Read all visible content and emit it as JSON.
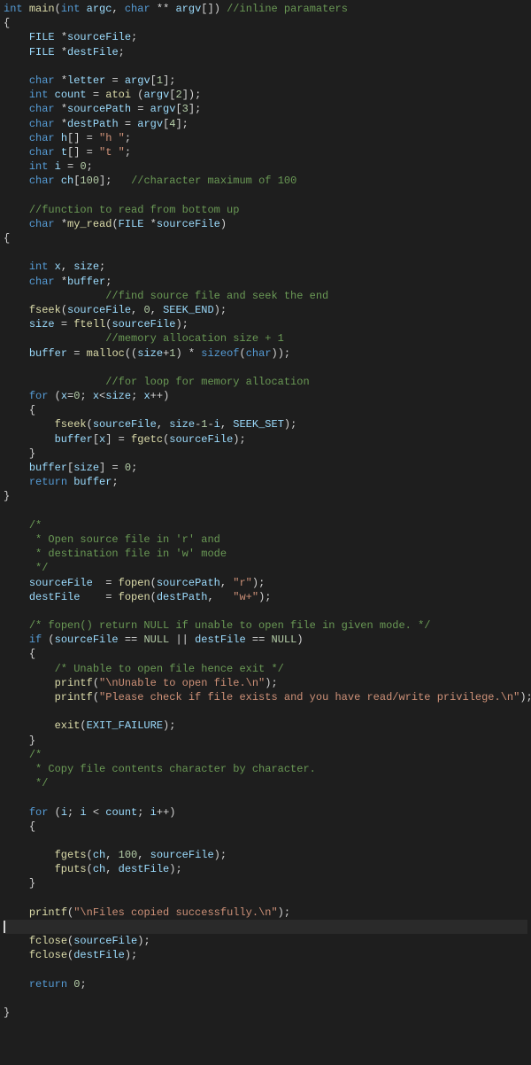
{
  "l": {
    "0": {
      "a": "int",
      "b": "main",
      "c": "int",
      "d": "argc",
      "e": "char",
      "f": "argv",
      "g": "//inline paramaters"
    },
    "1": {
      "a": "{"
    },
    "2": {
      "a": "FILE",
      "b": "sourceFile"
    },
    "3": {
      "a": "FILE",
      "b": "destFile"
    },
    "5": {
      "a": "char",
      "b": "letter",
      "c": "argv",
      "d": "1"
    },
    "6": {
      "a": "int",
      "b": "count",
      "c": "atoi",
      "d": "argv",
      "e": "2"
    },
    "7": {
      "a": "char",
      "b": "sourcePath",
      "c": "argv",
      "d": "3"
    },
    "8": {
      "a": "char",
      "b": "destPath",
      "c": "argv",
      "d": "4"
    },
    "9": {
      "a": "char",
      "b": "h",
      "c": "\"h \""
    },
    "10": {
      "a": "char",
      "b": "t",
      "c": "\"t \""
    },
    "11": {
      "a": "int",
      "b": "i",
      "c": "0"
    },
    "12": {
      "a": "char",
      "b": "ch",
      "c": "100",
      "d": "//character maximum of 100"
    },
    "14": {
      "a": "//function to read from bottom up"
    },
    "15": {
      "a": "char",
      "b": "my_read",
      "c": "FILE",
      "d": "sourceFile"
    },
    "16": {
      "a": "{"
    },
    "18": {
      "a": "int",
      "b": "x",
      "c": "size"
    },
    "19": {
      "a": "char",
      "b": "buffer"
    },
    "20": {
      "a": "//find source file and seek the end"
    },
    "21": {
      "a": "fseek",
      "b": "sourceFile",
      "c": "0",
      "d": "SEEK_END"
    },
    "22": {
      "a": "size",
      "b": "ftell",
      "c": "sourceFile"
    },
    "23": {
      "a": "//memory allocation size + 1"
    },
    "24": {
      "a": "buffer",
      "b": "malloc",
      "c": "size",
      "d": "1",
      "e": "sizeof",
      "f": "char"
    },
    "26": {
      "a": "//for loop for memory allocation"
    },
    "27": {
      "a": "for",
      "b": "x",
      "c": "0",
      "d": "x",
      "e": "size",
      "f": "x"
    },
    "28": {
      "a": "{"
    },
    "29": {
      "a": "fseek",
      "b": "sourceFile",
      "c": "size",
      "d": "1",
      "e": "i",
      "f": "SEEK_SET"
    },
    "30": {
      "a": "buffer",
      "b": "x",
      "c": "fgetc",
      "d": "sourceFile"
    },
    "31": {
      "a": "}"
    },
    "32": {
      "a": "buffer",
      "b": "size",
      "c": "0"
    },
    "33": {
      "a": "return",
      "b": "buffer"
    },
    "34": {
      "a": "}"
    },
    "36": {
      "a": "/*"
    },
    "37": {
      "a": "     * Open source file in 'r' and"
    },
    "38": {
      "a": "     * destination file in 'w' mode"
    },
    "39": {
      "a": "     */"
    },
    "40": {
      "a": "sourceFile",
      "b": "fopen",
      "c": "sourcePath",
      "d": "\"r\""
    },
    "41": {
      "a": "destFile",
      "b": "fopen",
      "c": "destPath",
      "d": "\"w+\""
    },
    "43": {
      "a": "/* fopen() return NULL if unable to open file in given mode. */"
    },
    "44": {
      "a": "if",
      "b": "sourceFile",
      "c": "NULL",
      "d": "destFile",
      "e": "NULL"
    },
    "45": {
      "a": "{"
    },
    "46": {
      "a": "/* Unable to open file hence exit */"
    },
    "47": {
      "a": "printf",
      "b": "\"\\nUnable to open file.\\n\""
    },
    "48": {
      "a": "printf",
      "b": "\"Please check if file exists and you have read/write privilege.\\n\""
    },
    "50": {
      "a": "exit",
      "b": "EXIT_FAILURE"
    },
    "51": {
      "a": "}"
    },
    "52": {
      "a": "/*"
    },
    "53": {
      "a": "     * Copy file contents character by character."
    },
    "54": {
      "a": "     */"
    },
    "56": {
      "a": "for",
      "b": "i",
      "c": "i",
      "d": "count",
      "e": "i"
    },
    "57": {
      "a": "{"
    },
    "59": {
      "a": "fgets",
      "b": "ch",
      "c": "100",
      "d": "sourceFile"
    },
    "60": {
      "a": "fputs",
      "b": "ch",
      "c": "destFile"
    },
    "61": {
      "a": "}"
    },
    "63": {
      "a": "printf",
      "b": "\"\\nFiles copied successfully.\\n\""
    },
    "65": {
      "a": "fclose",
      "b": "sourceFile"
    },
    "66": {
      "a": "fclose",
      "b": "destFile"
    },
    "68": {
      "a": "return",
      "b": "0"
    },
    "70": {
      "a": "}"
    }
  }
}
